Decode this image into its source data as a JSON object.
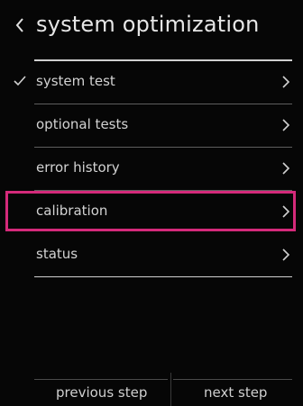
{
  "header": {
    "title": "system optimization",
    "back_icon": "chevron-left-icon"
  },
  "menu": {
    "items": [
      {
        "label": "system test",
        "checked": true,
        "chevron_icon": "chevron-right-icon"
      },
      {
        "label": "optional tests",
        "checked": false,
        "chevron_icon": "chevron-right-icon"
      },
      {
        "label": "error history",
        "checked": false,
        "chevron_icon": "chevron-right-icon"
      },
      {
        "label": "calibration",
        "checked": false,
        "highlighted": true,
        "chevron_icon": "chevron-right-icon"
      },
      {
        "label": "status",
        "checked": false,
        "chevron_icon": "chevron-right-icon"
      }
    ],
    "highlight_color": "#d42a7a"
  },
  "footer": {
    "previous_label": "previous step",
    "next_label": "next step"
  }
}
